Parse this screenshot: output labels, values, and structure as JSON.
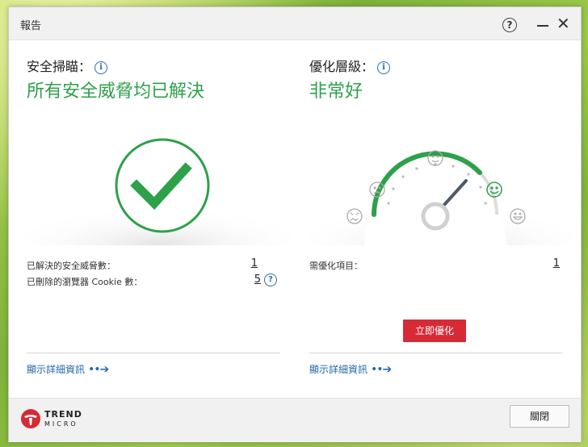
{
  "window": {
    "title": "報告",
    "help_label": "?",
    "close_label": "✕"
  },
  "left_panel": {
    "heading": "安全掃瞄：",
    "status": "所有安全威脅均已解決",
    "stats": [
      {
        "label": "已解決的安全威脅數：",
        "value": "1"
      },
      {
        "label": "已刪除的瀏覽器 Cookie 數：",
        "value": "5"
      }
    ],
    "details_link": "顯示詳細資訊",
    "status_color": "#2ea04a"
  },
  "right_panel": {
    "heading": "優化層級：",
    "status": "非常好",
    "stats": [
      {
        "label": "需優化項目：",
        "value": "1"
      }
    ],
    "optimize_button": "立即優化",
    "details_link": "顯示詳細資訊",
    "gauge_level": 0.85
  },
  "footer": {
    "brand_line1": "TREND",
    "brand_line2": "MICRO",
    "close_button": "關閉"
  },
  "colors": {
    "accent_green": "#2ea04a",
    "link_blue": "#2468a8",
    "danger_red": "#d62b36"
  }
}
